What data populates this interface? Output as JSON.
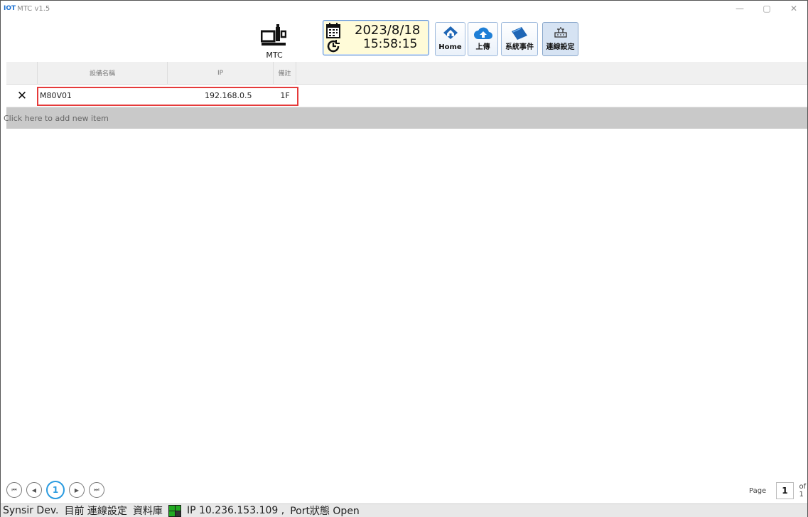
{
  "window": {
    "logo": "IOT",
    "title": "MTC v1.5"
  },
  "toolbar": {
    "machine_label": "MTC",
    "date": "2023/8/18",
    "time": "15:58:15",
    "buttons": [
      {
        "label": "Home",
        "icon": "home-icon"
      },
      {
        "label": "上傳",
        "icon": "cloud-upload-icon"
      },
      {
        "label": "系統事件",
        "icon": "event-ticket-icon"
      },
      {
        "label": "連線設定",
        "icon": "network-settings-icon"
      }
    ]
  },
  "grid": {
    "columns": [
      "設備名稱",
      "IP",
      "備註"
    ],
    "rows": [
      {
        "name": "M80V01",
        "ip": "192.168.0.5",
        "note": "1F"
      }
    ],
    "add_new": "Click here to add new item"
  },
  "pager": {
    "current": "1",
    "page_label": "Page",
    "page_value": "1",
    "of_label": "of 1"
  },
  "status": {
    "dev": "Synsir Dev.",
    "current": "目前 連線設定",
    "db": "資料庫",
    "ip": "IP 10.236.153.109 ,",
    "port": "Port狀態 Open"
  },
  "colors": {
    "highlight": "#e53a3a",
    "accent": "#2a9be0",
    "db_status": "#22aa22"
  }
}
